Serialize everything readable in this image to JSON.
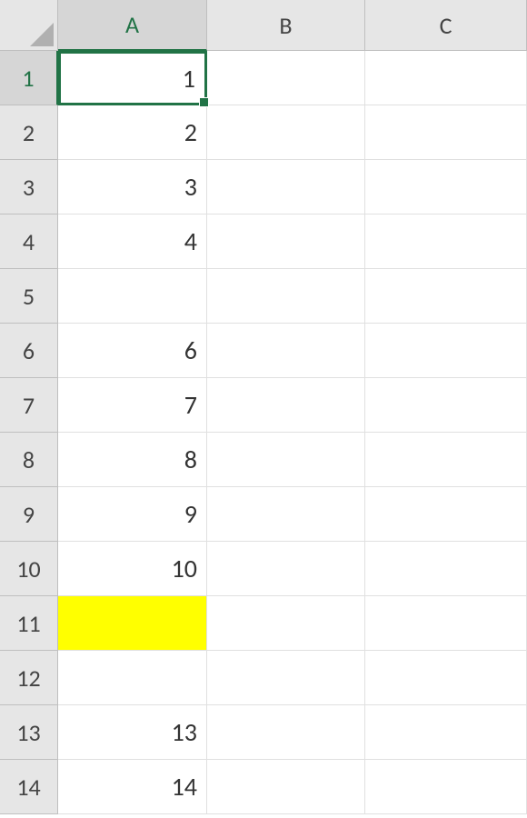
{
  "columns": [
    {
      "label": "A",
      "class": "col-A",
      "active": true
    },
    {
      "label": "B",
      "class": "col-B",
      "active": false
    },
    {
      "label": "C",
      "class": "col-C",
      "active": false
    }
  ],
  "rows": [
    {
      "num": "1",
      "active": true,
      "cells": [
        {
          "value": "1",
          "selected": true
        },
        {
          "value": ""
        },
        {
          "value": ""
        }
      ]
    },
    {
      "num": "2",
      "active": false,
      "cells": [
        {
          "value": "2"
        },
        {
          "value": ""
        },
        {
          "value": ""
        }
      ]
    },
    {
      "num": "3",
      "active": false,
      "cells": [
        {
          "value": "3"
        },
        {
          "value": ""
        },
        {
          "value": ""
        }
      ]
    },
    {
      "num": "4",
      "active": false,
      "cells": [
        {
          "value": "4"
        },
        {
          "value": ""
        },
        {
          "value": ""
        }
      ]
    },
    {
      "num": "5",
      "active": false,
      "cells": [
        {
          "value": ""
        },
        {
          "value": ""
        },
        {
          "value": ""
        }
      ]
    },
    {
      "num": "6",
      "active": false,
      "cells": [
        {
          "value": "6"
        },
        {
          "value": ""
        },
        {
          "value": ""
        }
      ]
    },
    {
      "num": "7",
      "active": false,
      "cells": [
        {
          "value": "7"
        },
        {
          "value": ""
        },
        {
          "value": ""
        }
      ]
    },
    {
      "num": "8",
      "active": false,
      "cells": [
        {
          "value": "8"
        },
        {
          "value": ""
        },
        {
          "value": ""
        }
      ]
    },
    {
      "num": "9",
      "active": false,
      "cells": [
        {
          "value": "9"
        },
        {
          "value": ""
        },
        {
          "value": ""
        }
      ]
    },
    {
      "num": "10",
      "active": false,
      "cells": [
        {
          "value": "10"
        },
        {
          "value": ""
        },
        {
          "value": ""
        }
      ]
    },
    {
      "num": "11",
      "active": false,
      "cells": [
        {
          "value": "",
          "highlighted": true
        },
        {
          "value": ""
        },
        {
          "value": ""
        }
      ]
    },
    {
      "num": "12",
      "active": false,
      "cells": [
        {
          "value": ""
        },
        {
          "value": ""
        },
        {
          "value": ""
        }
      ]
    },
    {
      "num": "13",
      "active": false,
      "cells": [
        {
          "value": "13"
        },
        {
          "value": ""
        },
        {
          "value": ""
        }
      ]
    },
    {
      "num": "14",
      "active": false,
      "cells": [
        {
          "value": "14"
        },
        {
          "value": ""
        },
        {
          "value": ""
        }
      ]
    }
  ],
  "chart_data": {
    "type": "table",
    "columns": [
      "A",
      "B",
      "C"
    ],
    "rows": [
      [
        1,
        null,
        null
      ],
      [
        2,
        null,
        null
      ],
      [
        3,
        null,
        null
      ],
      [
        4,
        null,
        null
      ],
      [
        null,
        null,
        null
      ],
      [
        6,
        null,
        null
      ],
      [
        7,
        null,
        null
      ],
      [
        8,
        null,
        null
      ],
      [
        9,
        null,
        null
      ],
      [
        10,
        null,
        null
      ],
      [
        null,
        null,
        null
      ],
      [
        null,
        null,
        null
      ],
      [
        13,
        null,
        null
      ],
      [
        14,
        null,
        null
      ]
    ],
    "selected_cell": "A1",
    "highlighted_cells": [
      "A11"
    ]
  }
}
